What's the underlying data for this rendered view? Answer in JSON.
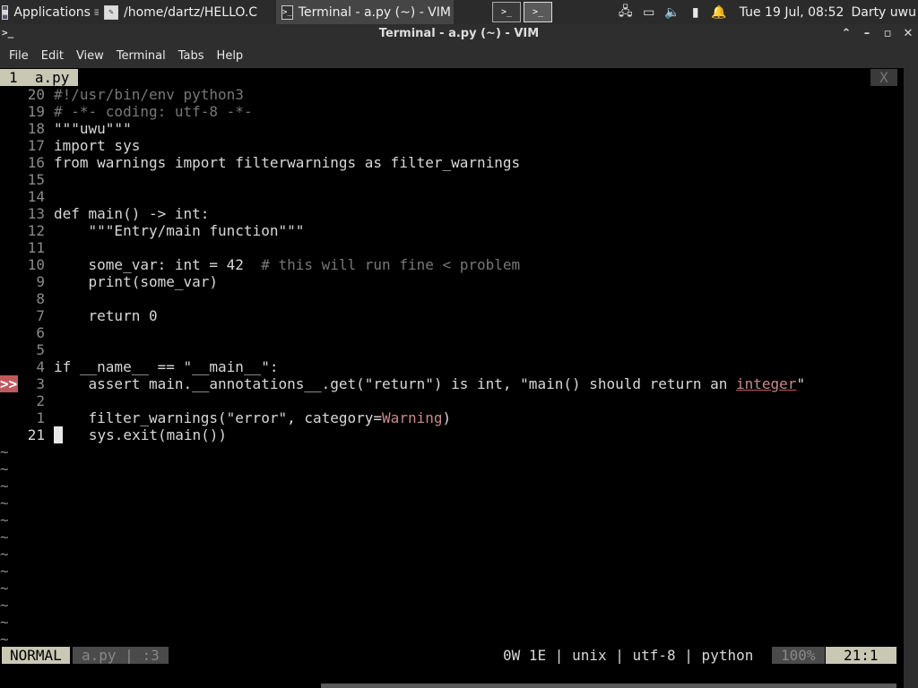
{
  "panel": {
    "applications_label": "Applications",
    "window_tasks": [
      {
        "label": "/home/dartz/HELLO.C",
        "active": false
      },
      {
        "label": "Terminal - a.py (~) - VIM",
        "active": true
      }
    ],
    "workspace_buttons": [
      ">_",
      ">_"
    ],
    "datetime": "Tue 19 Jul, 08:52",
    "user": "Darty uwu"
  },
  "window": {
    "title": "Terminal - a.py (~) - VIM"
  },
  "menubar": {
    "items": [
      "File",
      "Edit",
      "View",
      "Terminal",
      "Tabs",
      "Help"
    ]
  },
  "vim": {
    "tab_label": "1  a.py",
    "tab_close": "X",
    "lines": [
      {
        "num": "20",
        "sign": "",
        "text": "#!/usr/bin/env python3",
        "cls": "cm"
      },
      {
        "num": "19",
        "sign": "",
        "text": "# -*- coding: utf-8 -*-",
        "cls": "cm"
      },
      {
        "num": "18",
        "sign": "",
        "text": "\"\"\"uwu\"\"\"",
        "cls": "str"
      },
      {
        "num": "17",
        "sign": "",
        "text": "import sys",
        "cls": ""
      },
      {
        "num": "16",
        "sign": "",
        "text": "from warnings import filterwarnings as filter_warnings",
        "cls": ""
      },
      {
        "num": "15",
        "sign": "",
        "text": "",
        "cls": ""
      },
      {
        "num": "14",
        "sign": "",
        "text": "",
        "cls": ""
      },
      {
        "num": "13",
        "sign": "",
        "text": "def main() -> int:",
        "cls": ""
      },
      {
        "num": "12",
        "sign": "",
        "text": "    \"\"\"Entry/main function\"\"\"",
        "cls": "str"
      },
      {
        "num": "11",
        "sign": "",
        "text": "",
        "cls": ""
      },
      {
        "num": "10",
        "sign": "",
        "text": "    some_var: int = 42  ",
        "comment": "# this will run fine < problem",
        "cls": ""
      },
      {
        "num": "9",
        "sign": "",
        "text": "    print(some_var)",
        "cls": ""
      },
      {
        "num": "8",
        "sign": "",
        "text": "",
        "cls": ""
      },
      {
        "num": "7",
        "sign": "",
        "text": "    return 0",
        "cls": ""
      },
      {
        "num": "6",
        "sign": "",
        "text": "",
        "cls": ""
      },
      {
        "num": "5",
        "sign": "",
        "text": "",
        "cls": ""
      },
      {
        "num": "4",
        "sign": "",
        "text": "if __name__ == \"__main__\":",
        "cls": ""
      },
      {
        "num": "3",
        "sign": ">>",
        "text": "    assert main.__annotations__.get(\"return\") is int, \"main() should return an ",
        "err_word": "integer",
        "tail": "\"",
        "cls": ""
      },
      {
        "num": "2",
        "sign": "",
        "text": "",
        "cls": ""
      },
      {
        "num": "1",
        "sign": "",
        "text": "    filter_warnings(\"error\", category=",
        "warn_word": "Warning",
        "tail": ")",
        "cls": ""
      },
      {
        "num": "21",
        "sign": "",
        "text": "    sys.exit(main())",
        "cls": "",
        "current": true
      }
    ],
    "tilde_count": 12,
    "tilde_char": "~",
    "status": {
      "mode": "NORMAL",
      "file": "a.py",
      "sep": "|",
      "line_info": ":3",
      "info": "0W 1E | unix | utf-8 | python",
      "percent": "100%",
      "position": "21:1"
    }
  }
}
